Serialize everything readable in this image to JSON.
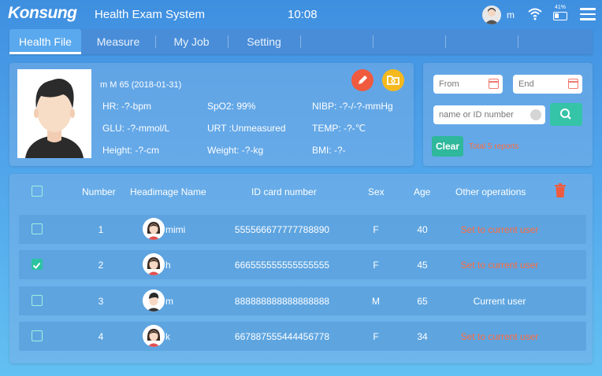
{
  "topbar": {
    "logo": "Konsung",
    "title": "Health Exam System",
    "time": "10:08",
    "user": "m",
    "battery": "41%",
    "battery_level": 0.41
  },
  "tabs": [
    {
      "label": "Health File",
      "active": true
    },
    {
      "label": "Measure",
      "active": false
    },
    {
      "label": "My Job",
      "active": false
    },
    {
      "label": "Setting",
      "active": false
    }
  ],
  "patient": {
    "header": "m   M   65   (2018-01-31)",
    "hr": "HR: -?-bpm",
    "spo2": "SpO2: 99%",
    "nibp": "NIBP: -?-/-?-mmHg",
    "glu": "GLU: -?-mmol/L",
    "urt": "URT :Unmeasured",
    "temp": "TEMP: -?-℃",
    "height": "Height: -?-cm",
    "weight": "Weight: -?-kg",
    "bmi": "BMI: -?-"
  },
  "search": {
    "from_placeholder": "From",
    "end_placeholder": "End",
    "query_placeholder": "name or ID number",
    "clear_label": "Clear",
    "total_text": "Total 5 reports"
  },
  "table": {
    "headers": {
      "number": "Number",
      "name": "Headimage Name",
      "id": "ID card number",
      "sex": "Sex",
      "age": "Age",
      "ops": "Other operations"
    },
    "rows": [
      {
        "number": "1",
        "name": "mimi",
        "id": "555566677777788890",
        "sex": "F",
        "age": "40",
        "op": "Set to current user",
        "checked": false,
        "gender": "female"
      },
      {
        "number": "2",
        "name": "h",
        "id": "666555555555555555",
        "sex": "F",
        "age": "45",
        "op": "Set to current user",
        "checked": true,
        "gender": "female"
      },
      {
        "number": "3",
        "name": "m",
        "id": "888888888888888888",
        "sex": "M",
        "age": "65",
        "op": "Current user",
        "checked": false,
        "gender": "male"
      },
      {
        "number": "4",
        "name": "k",
        "id": "667887555444456778",
        "sex": "F",
        "age": "34",
        "op": "Set to current user",
        "checked": false,
        "gender": "female"
      }
    ]
  },
  "colors": {
    "accent_green": "#2bc3a2",
    "link_orange": "#ff6a3d",
    "edit_red": "#f05a3e",
    "folder_yellow": "#f5b91e"
  },
  "icons": {
    "edit": "pencil-icon",
    "folder": "folder-icon",
    "calendar": "calendar-icon",
    "search": "search-icon",
    "delete": "trash-icon",
    "menu": "hamburger-menu-icon",
    "wifi": "wifi-icon",
    "battery": "battery-icon"
  }
}
